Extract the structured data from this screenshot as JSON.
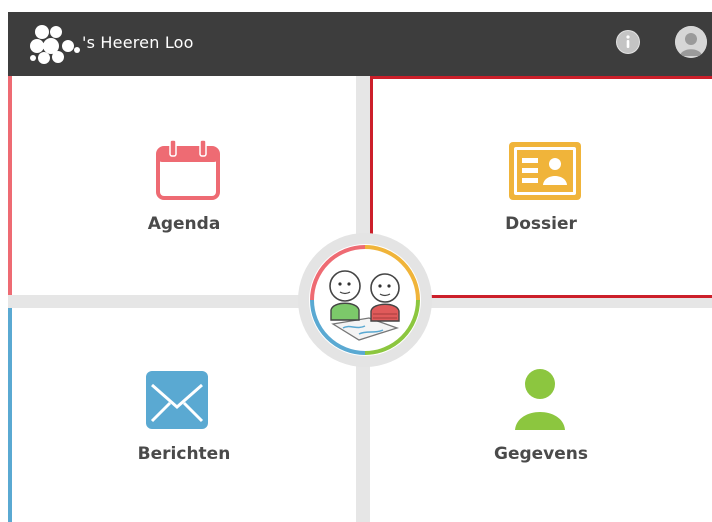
{
  "header": {
    "brand_name": "'s Heeren Loo",
    "info_icon": "info-icon",
    "user_icon": "user-avatar-icon",
    "background_color": "#3d3d3d"
  },
  "tiles": {
    "agenda": {
      "label": "Agenda",
      "icon": "calendar-icon",
      "color": "#ee6b73"
    },
    "dossier": {
      "label": "Dossier",
      "icon": "id-card-icon",
      "color": "#f0b43a"
    },
    "berichten": {
      "label": "Berichten",
      "icon": "envelope-icon",
      "color": "#5aa9d2"
    },
    "gegevens": {
      "label": "Gegevens",
      "icon": "person-icon",
      "color": "#8cc63f"
    }
  },
  "center_illustration": "two-cartoon-figures-with-map"
}
